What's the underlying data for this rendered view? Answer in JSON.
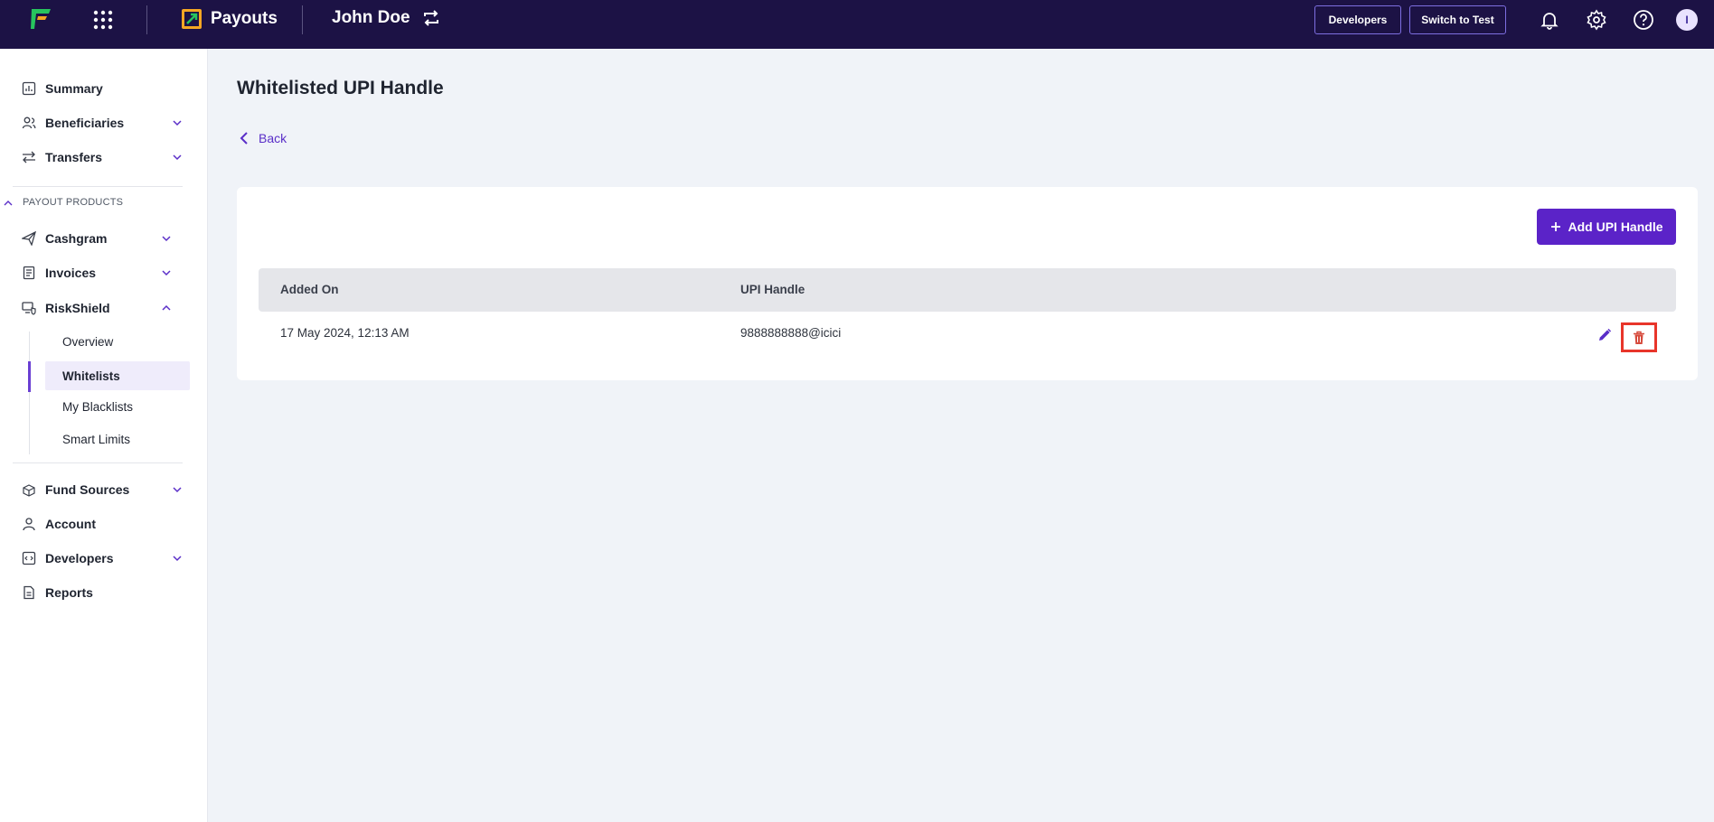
{
  "topbar": {
    "product_name": "Payouts",
    "merchant_name": "John Doe",
    "developers_label": "Developers",
    "switch_label": "Switch to Test",
    "avatar_initial": "I",
    "icons": [
      "logo-icon",
      "apps-grid-icon",
      "payouts-logo-icon",
      "switch-account-icon",
      "bell-icon",
      "gear-icon",
      "help-icon"
    ]
  },
  "sidebar": {
    "summary": "Summary",
    "beneficiaries": "Beneficiaries",
    "transfers": "Transfers",
    "section_label": "PAYOUT PRODUCTS",
    "cashgram": "Cashgram",
    "invoices": "Invoices",
    "riskshield": "RiskShield",
    "sub": {
      "overview": "Overview",
      "whitelists": "Whitelists",
      "blacklists": "My Blacklists",
      "limits": "Smart Limits"
    },
    "fund_sources": "Fund Sources",
    "account": "Account",
    "developers": "Developers",
    "reports": "Reports"
  },
  "main": {
    "title": "Whitelisted UPI Handle",
    "back_label": "Back",
    "add_button": "Add UPI Handle",
    "columns": [
      "Added On",
      "UPI Handle"
    ],
    "rows": [
      {
        "added_on": "17 May 2024, 12:13 AM",
        "upi_handle": "9888888888@icici"
      }
    ]
  },
  "colors": {
    "topbar_bg": "#1c1245",
    "accent": "#5b23c8",
    "highlight_border": "#e8352a"
  }
}
